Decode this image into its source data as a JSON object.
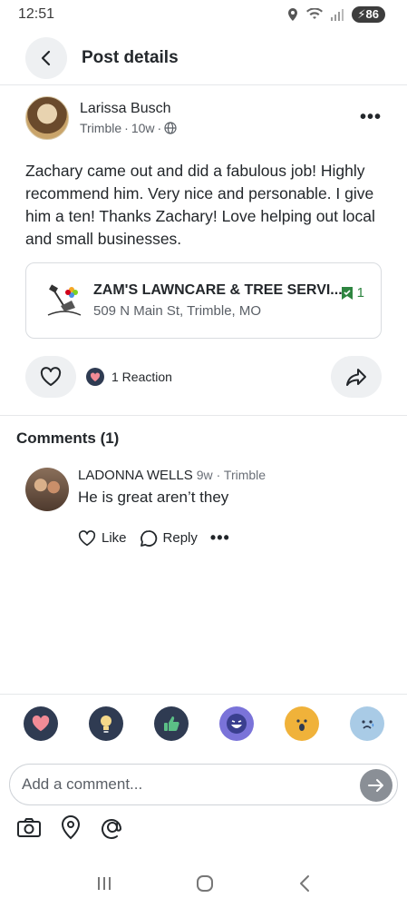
{
  "status_bar": {
    "time": "12:51",
    "battery": "86"
  },
  "header": {
    "title": "Post details"
  },
  "post": {
    "author": "Larissa Busch",
    "location": "Trimble",
    "age": "10w",
    "separator": "·",
    "body": "Zachary came out and did a fabulous job! Highly recommend him. Very nice and personable. I give him a ten! Thanks Zachary! Love helping out local and small businesses."
  },
  "business": {
    "name": "ZAM'S LAWNCARE & TREE SERVI...",
    "address": "509 N Main St, Trimble, MO",
    "recommend_count": "1",
    "accent_color": "#2e8540"
  },
  "reactions": {
    "summary": "1 Reaction"
  },
  "comments": {
    "title": "Comments (1)",
    "items": [
      {
        "author": "LADONNA WELLS",
        "age": "9w",
        "location": "· Trimble",
        "text": "He is great aren’t they",
        "like_label": "Like",
        "reply_label": "Reply",
        "more_label": "•••"
      }
    ]
  },
  "composer": {
    "placeholder": "Add a comment..."
  },
  "reaction_picker": [
    "heart-icon",
    "lightbulb-icon",
    "thumbs-up-icon",
    "laugh-face-icon",
    "wow-face-icon",
    "sad-face-icon"
  ]
}
